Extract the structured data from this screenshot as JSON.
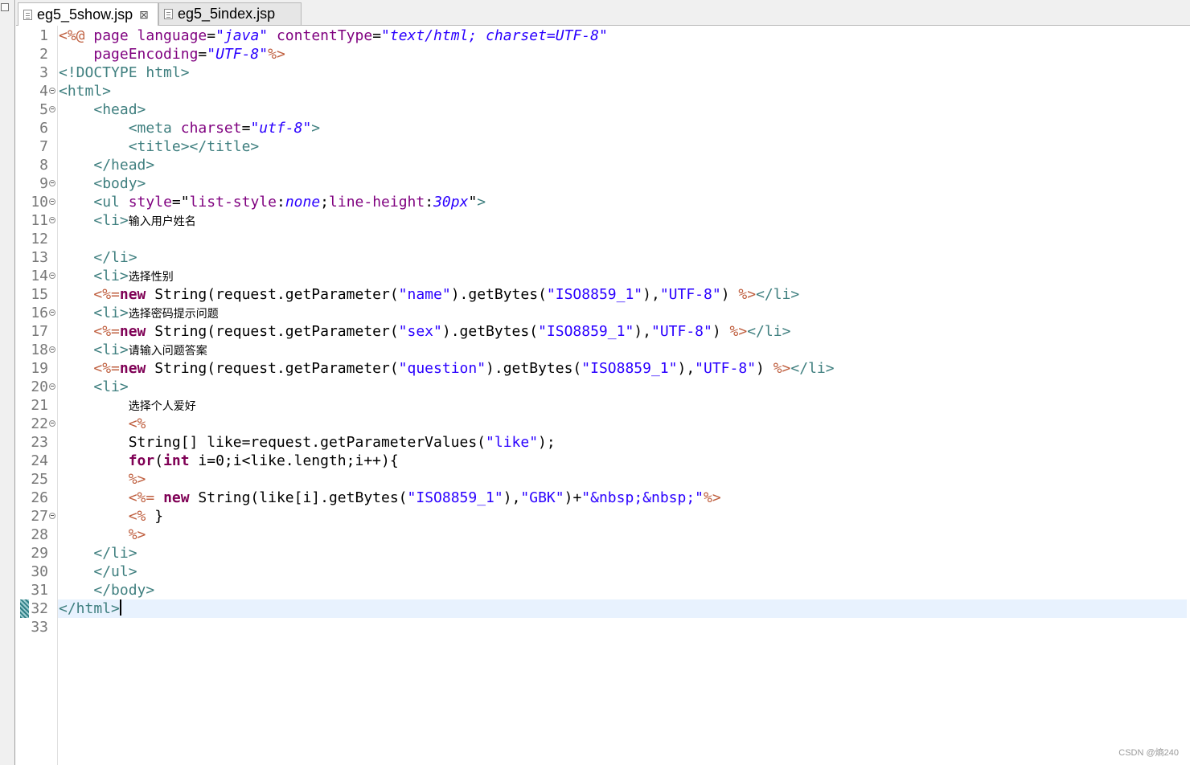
{
  "tabs": [
    {
      "label": "eg5_5show.jsp",
      "active": true,
      "close": "⊠"
    },
    {
      "label": "eg5_5index.jsp",
      "active": false
    }
  ],
  "editor": {
    "current_line": 32,
    "lines": [
      {
        "n": "1",
        "fold": false,
        "tokens": [
          [
            "jsp",
            "<%@ "
          ],
          [
            "attr",
            "page "
          ],
          [
            "attr",
            "language"
          ],
          [
            "plain",
            "="
          ],
          [
            "str",
            "\"java\""
          ],
          [
            "plain",
            " "
          ],
          [
            "attr",
            "contentType"
          ],
          [
            "plain",
            "="
          ],
          [
            "str",
            "\"text/html; charset=UTF-8\""
          ]
        ]
      },
      {
        "n": "2",
        "fold": false,
        "tokens": [
          [
            "plain",
            "    "
          ],
          [
            "attr",
            "pageEncoding"
          ],
          [
            "plain",
            "="
          ],
          [
            "str",
            "\"UTF-8\""
          ],
          [
            "jsp",
            "%>"
          ]
        ]
      },
      {
        "n": "3",
        "fold": false,
        "tokens": [
          [
            "tag",
            "<!DOCTYPE html>"
          ]
        ]
      },
      {
        "n": "4",
        "fold": true,
        "tokens": [
          [
            "tag",
            "<html>"
          ]
        ]
      },
      {
        "n": "5",
        "fold": true,
        "tokens": [
          [
            "plain",
            "    "
          ],
          [
            "tag",
            "<head>"
          ]
        ]
      },
      {
        "n": "6",
        "fold": false,
        "tokens": [
          [
            "plain",
            "        "
          ],
          [
            "tag",
            "<meta "
          ],
          [
            "attr",
            "charset"
          ],
          [
            "plain",
            "="
          ],
          [
            "str",
            "\"utf-8\""
          ],
          [
            "tag",
            ">"
          ]
        ]
      },
      {
        "n": "7",
        "fold": false,
        "tokens": [
          [
            "plain",
            "        "
          ],
          [
            "tag",
            "<title></title>"
          ]
        ]
      },
      {
        "n": "8",
        "fold": false,
        "tokens": [
          [
            "plain",
            "    "
          ],
          [
            "tag",
            "</head>"
          ]
        ]
      },
      {
        "n": "9",
        "fold": true,
        "tokens": [
          [
            "plain",
            "    "
          ],
          [
            "tag",
            "<body>"
          ]
        ]
      },
      {
        "n": "10",
        "fold": true,
        "tokens": [
          [
            "plain",
            "    "
          ],
          [
            "tag",
            "<ul "
          ],
          [
            "attr",
            "style"
          ],
          [
            "plain",
            "=\""
          ],
          [
            "attr",
            "list-style"
          ],
          [
            "plain",
            ":"
          ],
          [
            "str",
            "none"
          ],
          [
            "plain",
            ";"
          ],
          [
            "attr",
            "line-height"
          ],
          [
            "plain",
            ":"
          ],
          [
            "str",
            "30px"
          ],
          [
            "plain",
            "\""
          ],
          [
            "tag",
            ">"
          ]
        ]
      },
      {
        "n": "11",
        "fold": true,
        "tokens": [
          [
            "plain",
            "    "
          ],
          [
            "tag",
            "<li>"
          ],
          [
            "cn",
            "输入用户姓名"
          ]
        ]
      },
      {
        "n": "12",
        "fold": false,
        "tokens": []
      },
      {
        "n": "13",
        "fold": false,
        "tokens": [
          [
            "plain",
            "    "
          ],
          [
            "tag",
            "</li>"
          ]
        ]
      },
      {
        "n": "14",
        "fold": true,
        "tokens": [
          [
            "plain",
            "    "
          ],
          [
            "tag",
            "<li>"
          ],
          [
            "cn",
            "选择性别"
          ]
        ]
      },
      {
        "n": "15",
        "fold": false,
        "tokens": [
          [
            "plain",
            "    "
          ],
          [
            "jsp",
            "<%="
          ],
          [
            "kw",
            "new"
          ],
          [
            "plain",
            " String(request.getParameter("
          ],
          [
            "jstr",
            "\"name\""
          ],
          [
            "plain",
            ").getBytes("
          ],
          [
            "jstr",
            "\"ISO8859_1\""
          ],
          [
            "plain",
            "),"
          ],
          [
            "jstr",
            "\"UTF-8\""
          ],
          [
            "plain",
            ") "
          ],
          [
            "jsp",
            "%>"
          ],
          [
            "tag",
            "</li>"
          ]
        ]
      },
      {
        "n": "16",
        "fold": true,
        "tokens": [
          [
            "plain",
            "    "
          ],
          [
            "tag",
            "<li>"
          ],
          [
            "cn",
            "选择密码提示问题"
          ]
        ]
      },
      {
        "n": "17",
        "fold": false,
        "tokens": [
          [
            "plain",
            "    "
          ],
          [
            "jsp",
            "<%="
          ],
          [
            "kw",
            "new"
          ],
          [
            "plain",
            " String(request.getParameter("
          ],
          [
            "jstr",
            "\"sex\""
          ],
          [
            "plain",
            ").getBytes("
          ],
          [
            "jstr",
            "\"ISO8859_1\""
          ],
          [
            "plain",
            "),"
          ],
          [
            "jstr",
            "\"UTF-8\""
          ],
          [
            "plain",
            ") "
          ],
          [
            "jsp",
            "%>"
          ],
          [
            "tag",
            "</li>"
          ]
        ]
      },
      {
        "n": "18",
        "fold": true,
        "tokens": [
          [
            "plain",
            "    "
          ],
          [
            "tag",
            "<li>"
          ],
          [
            "cn",
            "请输入问题答案"
          ]
        ]
      },
      {
        "n": "19",
        "fold": false,
        "tokens": [
          [
            "plain",
            "    "
          ],
          [
            "jsp",
            "<%="
          ],
          [
            "kw",
            "new"
          ],
          [
            "plain",
            " String(request.getParameter("
          ],
          [
            "jstr",
            "\"question\""
          ],
          [
            "plain",
            ").getBytes("
          ],
          [
            "jstr",
            "\"ISO8859_1\""
          ],
          [
            "plain",
            "),"
          ],
          [
            "jstr",
            "\"UTF-8\""
          ],
          [
            "plain",
            ") "
          ],
          [
            "jsp",
            "%>"
          ],
          [
            "tag",
            "</li>"
          ]
        ]
      },
      {
        "n": "20",
        "fold": true,
        "tokens": [
          [
            "plain",
            "    "
          ],
          [
            "tag",
            "<li>"
          ]
        ]
      },
      {
        "n": "21",
        "fold": false,
        "tokens": [
          [
            "plain",
            "        "
          ],
          [
            "cn",
            "选择个人爱好"
          ]
        ]
      },
      {
        "n": "22",
        "fold": true,
        "tokens": [
          [
            "plain",
            "        "
          ],
          [
            "jsp",
            "<%"
          ]
        ]
      },
      {
        "n": "23",
        "fold": false,
        "tokens": [
          [
            "plain",
            "        String[] like=request.getParameterValues("
          ],
          [
            "jstr",
            "\"like\""
          ],
          [
            "plain",
            ");"
          ]
        ]
      },
      {
        "n": "24",
        "fold": false,
        "tokens": [
          [
            "plain",
            "        "
          ],
          [
            "kw",
            "for"
          ],
          [
            "plain",
            "("
          ],
          [
            "kw",
            "int"
          ],
          [
            "plain",
            " i=0;i<like.length;i++){"
          ]
        ]
      },
      {
        "n": "25",
        "fold": false,
        "tokens": [
          [
            "plain",
            "        "
          ],
          [
            "jsp",
            "%>"
          ]
        ]
      },
      {
        "n": "26",
        "fold": false,
        "tokens": [
          [
            "plain",
            "        "
          ],
          [
            "jsp",
            "<%="
          ],
          [
            "plain",
            " "
          ],
          [
            "kw",
            "new"
          ],
          [
            "plain",
            " String(like[i].getBytes("
          ],
          [
            "jstr",
            "\"ISO8859_1\""
          ],
          [
            "plain",
            "),"
          ],
          [
            "jstr",
            "\"GBK\""
          ],
          [
            "plain",
            ")+"
          ],
          [
            "jstr",
            "\"&nbsp;&nbsp;\""
          ],
          [
            "jsp",
            "%>"
          ]
        ]
      },
      {
        "n": "27",
        "fold": true,
        "tokens": [
          [
            "plain",
            "        "
          ],
          [
            "jsp",
            "<%"
          ],
          [
            "plain",
            " }"
          ]
        ]
      },
      {
        "n": "28",
        "fold": false,
        "tokens": [
          [
            "plain",
            "        "
          ],
          [
            "jsp",
            "%>"
          ]
        ]
      },
      {
        "n": "29",
        "fold": false,
        "tokens": [
          [
            "plain",
            "    "
          ],
          [
            "tag",
            "</li>"
          ]
        ]
      },
      {
        "n": "30",
        "fold": false,
        "tokens": [
          [
            "plain",
            "    "
          ],
          [
            "tag",
            "</ul>"
          ]
        ]
      },
      {
        "n": "31",
        "fold": false,
        "tokens": [
          [
            "plain",
            "    "
          ],
          [
            "tag",
            "</body>"
          ]
        ]
      },
      {
        "n": "32",
        "fold": false,
        "caret": true,
        "tokens": [
          [
            "tag",
            "</html>"
          ]
        ]
      },
      {
        "n": "33",
        "fold": false,
        "tokens": []
      }
    ]
  },
  "watermark": "CSDN @熵240"
}
